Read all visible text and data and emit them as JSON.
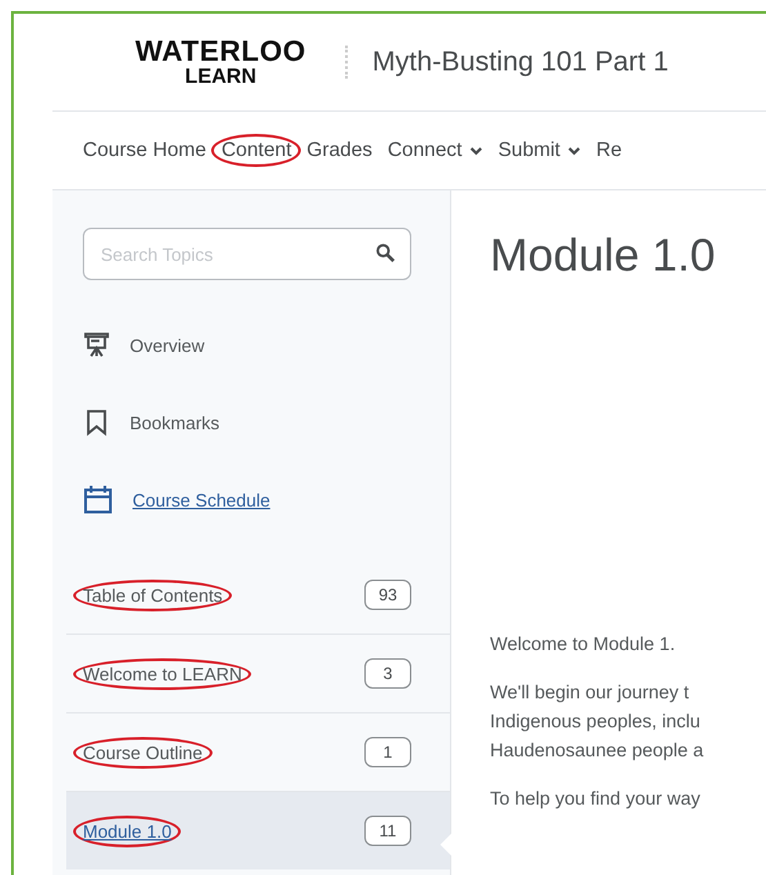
{
  "header": {
    "logo": [
      "WATERLOO",
      "LEARN"
    ],
    "course_title": "Myth-Busting 101 Part 1"
  },
  "nav": [
    {
      "label": "Course Home",
      "dropdown": false,
      "highlighted": false
    },
    {
      "label": "Content",
      "dropdown": false,
      "highlighted": true
    },
    {
      "label": "Grades",
      "dropdown": false,
      "highlighted": false
    },
    {
      "label": "Connect",
      "dropdown": true,
      "highlighted": false
    },
    {
      "label": "Submit",
      "dropdown": true,
      "highlighted": false
    },
    {
      "label": "Re",
      "dropdown": false,
      "highlighted": false
    }
  ],
  "sidebar": {
    "search": {
      "placeholder": "Search Topics"
    },
    "tools": [
      {
        "kind": "overview",
        "label": "Overview",
        "link": false
      },
      {
        "kind": "bookmarks",
        "label": "Bookmarks",
        "link": false
      },
      {
        "kind": "schedule",
        "label": "Course Schedule",
        "link": true
      }
    ],
    "modules": [
      {
        "label": "Table of Contents",
        "count": "93",
        "selected": false,
        "highlighted": true
      },
      {
        "label": "Welcome to LEARN",
        "count": "3",
        "selected": false,
        "highlighted": true
      },
      {
        "label": "Course Outline",
        "count": "1",
        "selected": false,
        "highlighted": true
      },
      {
        "label": "Module 1.0",
        "count": "11",
        "selected": true,
        "highlighted": true
      }
    ]
  },
  "main": {
    "title": "Module 1.0",
    "paragraphs": [
      [
        "Welcome to Module 1."
      ],
      [
        "We'll begin our journey t",
        "Indigenous peoples, inclu",
        "Haudenosaunee people a"
      ],
      [
        "To help you find your way"
      ]
    ]
  }
}
